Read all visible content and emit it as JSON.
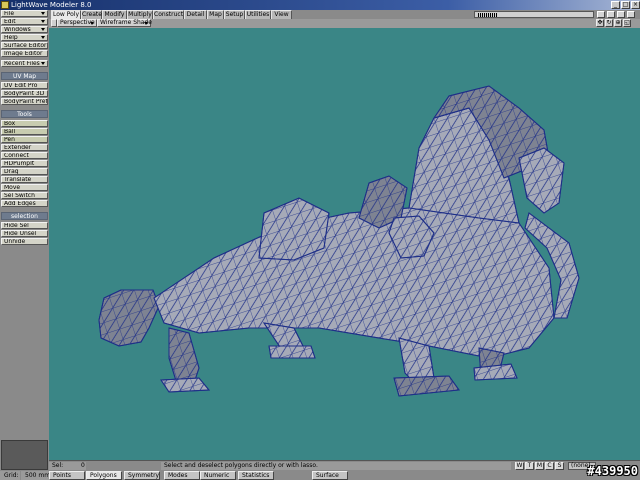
{
  "window": {
    "title": "LightWave Modeler 8.0"
  },
  "sidebar": {
    "menus": [
      "File",
      "Edit",
      "Windows",
      "Help"
    ],
    "editors": [
      "Surface Editor",
      "Image Editor"
    ],
    "recent": "Recent Files",
    "uvmap_header": "UV Map",
    "uvmap_items": [
      "UV Edit Pro",
      "BodyPaint 3D",
      "BodyPaint Prefs"
    ],
    "tools_header": "Tools",
    "tools_items": [
      "Box",
      "Ball",
      "Pen",
      "Extender",
      "Connect",
      "HDPumpIt",
      "Drag",
      "Translate",
      "Move",
      "Sel Switch",
      "Add Edges"
    ],
    "selection_header": "selection",
    "selection_items": [
      "Hide Sel",
      "Hide Unsel",
      "Unhide"
    ]
  },
  "tabs": [
    "Low Poly",
    "Create",
    "Modify",
    "Multiply",
    "Construct",
    "Detail",
    "Map",
    "Setup",
    "Utilities",
    "View"
  ],
  "active_tab": "Low Poly",
  "viewport": {
    "view": "Perspective",
    "shade": "Wireframe Shade",
    "background_color": "#3a8686",
    "mesh_fill": "#a6aab8",
    "mesh_shadow": "#7e8392",
    "wire_color": "#1e2f88"
  },
  "status": {
    "sel_label": "Sel:",
    "sel_value": "0",
    "help": "Select and deselect polygons directly or with lasso.",
    "mode_buttons": [
      "W",
      "T",
      "M",
      "C",
      "S"
    ],
    "layer": "(none)"
  },
  "bottom": {
    "grid_label": "Grid:",
    "grid_value": "500 mm",
    "points": "Points",
    "polygons": "Polygons",
    "symmetry": "Symmetry",
    "modes": "Modes",
    "numeric": "Numeric",
    "statistics": "Statistics",
    "surface": "Surface"
  },
  "watermark": "#439950"
}
